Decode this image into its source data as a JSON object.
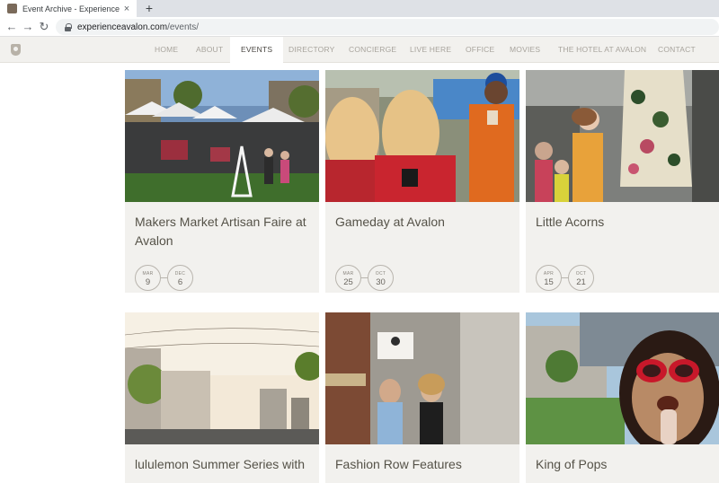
{
  "browser": {
    "tab_title": "Event Archive - Experience Avalon",
    "close_glyph": "×",
    "new_tab_glyph": "+",
    "back_glyph": "←",
    "forward_glyph": "→",
    "reload_glyph": "↻",
    "url_host": "experienceavalon.com",
    "url_path": "/events/"
  },
  "nav": {
    "items": [
      {
        "label": "HOME"
      },
      {
        "label": "ABOUT"
      },
      {
        "label": "EVENTS",
        "active": true
      },
      {
        "label": "DIRECTORY"
      },
      {
        "label": "CONCIERGE"
      },
      {
        "label": "LIVE HERE"
      },
      {
        "label": "OFFICE"
      },
      {
        "label": "MOVIES"
      },
      {
        "label": "THE HOTEL AT AVALON"
      },
      {
        "label": "CONTACT"
      }
    ]
  },
  "events": [
    {
      "title": "Makers Market Artisan Faire at Avalon",
      "start": {
        "month": "MAR",
        "day": "9"
      },
      "end": {
        "month": "DEC",
        "day": "6"
      },
      "image": "market-tents-photo"
    },
    {
      "title": "Gameday at Avalon",
      "start": {
        "month": "MAR",
        "day": "25"
      },
      "end": {
        "month": "OCT",
        "day": "30"
      },
      "image": "football-fans-photo"
    },
    {
      "title": "Little Acorns",
      "start": {
        "month": "APR",
        "day": "15"
      },
      "end": {
        "month": "OCT",
        "day": "21"
      },
      "image": "kids-dancing-photo"
    },
    {
      "title": "lululemon Summer Series with",
      "image": "street-buildings-photo"
    },
    {
      "title": "Fashion Row Features",
      "image": "shopping-women-photo"
    },
    {
      "title": "King of Pops",
      "image": "girl-popsicle-photo"
    }
  ],
  "theme": {
    "card_bg": "#f2f1ee",
    "nav_bg": "#f2f1ee",
    "text": "#555248",
    "nav_text": "#a8a49d"
  }
}
